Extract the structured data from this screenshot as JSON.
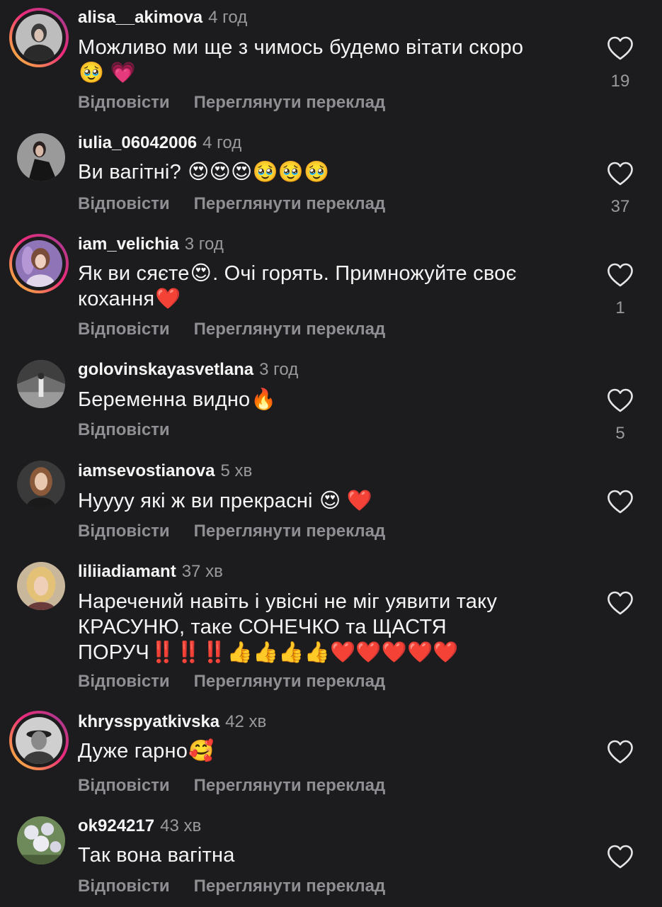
{
  "labels": {
    "reply": "Відповісти",
    "translate": "Переглянути переклад"
  },
  "colors": {
    "background": "#1c1c1e",
    "story_ring": [
      "#f9ce34",
      "#ee2a7b",
      "#8a3ab9"
    ],
    "secondary_text": "#8e8e93"
  },
  "comments": [
    {
      "username": "alisa__akimova",
      "time": "4 год",
      "text_line1": "Можливо ми ще з чимось будемо вітати скоро",
      "text_line2_emojis": "🥹 💗",
      "likes": "19"
    },
    {
      "username": "iulia_06042006",
      "time": "4 год",
      "text": "Ви вагітні?",
      "emojis": "😍😍😍🥹🥹🥹",
      "likes": "37"
    },
    {
      "username": "iam_velichia",
      "time": "3 год",
      "text_a": "Як ви сяєте",
      "emoji_a": "😍",
      "text_b": ". Очі горять. Примножуйте своє",
      "text_line2": "кохання",
      "emoji_b": "❤️",
      "likes": "1"
    },
    {
      "username": "golovinskayasvetlana",
      "time": "3 год",
      "text": "Беременна видно",
      "emoji": "🔥",
      "likes": "5"
    },
    {
      "username": "iamsevostianova",
      "time": "5 хв",
      "text": "Нуууу які ж ви прекрасні",
      "emojis": "😍 ❤️"
    },
    {
      "username": "liliiadiamant",
      "time": "37 хв",
      "text_line1": "Наречений навіть і увісні не міг уявити  таку",
      "text_line2": "КРАСУНЮ, таке СОНЕЧКО  та ЩАСТЯ",
      "text_line3": "ПОРУЧ",
      "emojis": "‼️‼️‼️👍👍👍👍❤️❤️❤️❤️❤️"
    },
    {
      "username": "khrysspyatkivska",
      "time": "42 хв",
      "text": "Дуже гарно",
      "emoji": "🥰"
    },
    {
      "username": "ok924217",
      "time": "43 хв",
      "text": "Так вона вагітна"
    }
  ]
}
